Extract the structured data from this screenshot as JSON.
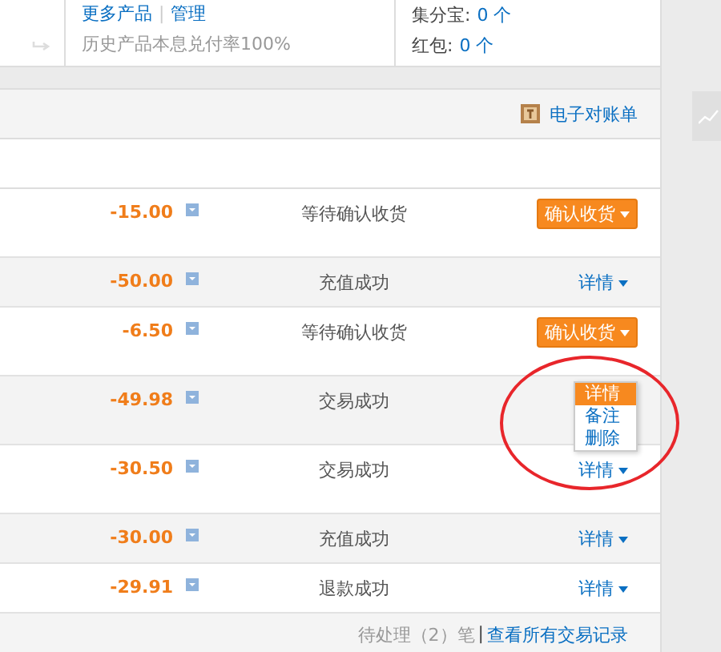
{
  "summary": {
    "products_links": [
      "更多产品",
      "管理"
    ],
    "links_separator": "|",
    "payout_rate": "历史产品本息兑付率100%",
    "points": {
      "label": "集分宝:",
      "value": "0 个"
    },
    "red_packets": {
      "label": "红包:",
      "value": "0 个"
    }
  },
  "toolbar": {
    "statement_link": "电子对账单"
  },
  "transactions": [
    {
      "amount": "-15.00",
      "status": "等待确认收货",
      "action": {
        "kind": "button",
        "label": "确认收货"
      },
      "shaded": false,
      "tall": true
    },
    {
      "amount": "-50.00",
      "status": "充值成功",
      "action": {
        "kind": "link",
        "label": "详情"
      },
      "shaded": true,
      "tall": false
    },
    {
      "amount": "-6.50",
      "status": "等待确认收货",
      "action": {
        "kind": "button",
        "label": "确认收货"
      },
      "shaded": false,
      "tall": true
    },
    {
      "amount": "-49.98",
      "status": "交易成功",
      "action": {
        "kind": "menu",
        "items": [
          {
            "label": "详情",
            "selected": true
          },
          {
            "label": "备注",
            "selected": false
          },
          {
            "label": "删除",
            "selected": false
          }
        ]
      },
      "shaded": true,
      "tall": true
    },
    {
      "amount": "-30.50",
      "status": "交易成功",
      "action": {
        "kind": "link",
        "label": "详情"
      },
      "shaded": false,
      "tall": true
    },
    {
      "amount": "-30.00",
      "status": "充值成功",
      "action": {
        "kind": "link",
        "label": "详情"
      },
      "shaded": true,
      "tall": false
    },
    {
      "amount": "-29.91",
      "status": "退款成功",
      "action": {
        "kind": "link",
        "label": "详情"
      },
      "shaded": false,
      "tall": false
    }
  ],
  "footer": {
    "pending": "待处理（2）笔",
    "separator": "|",
    "all_link": "查看所有交易记录"
  }
}
